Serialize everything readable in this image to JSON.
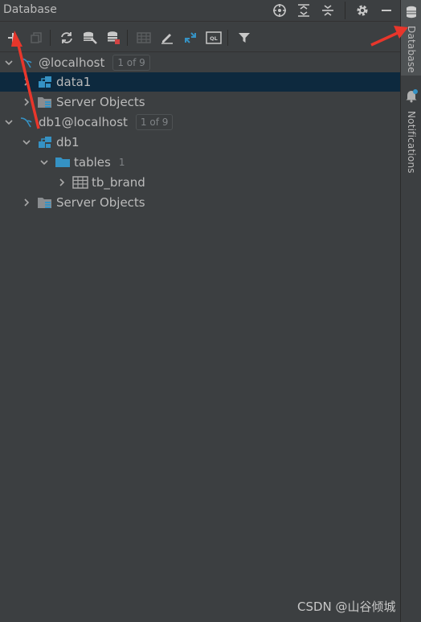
{
  "panel": {
    "title": "Database"
  },
  "title_actions": [
    "target-icon",
    "expand-all-icon",
    "collapse-all-icon",
    "gear-icon",
    "minimize-icon"
  ],
  "toolbar": {
    "icons": [
      "add-icon",
      "copy-icon",
      "refresh-icon",
      "data-source-properties-icon",
      "db-stop-icon",
      "table-view-icon",
      "edit-icon",
      "jump-to-source-icon",
      "query-console-icon",
      "filter-icon"
    ]
  },
  "tree": [
    {
      "label": "@localhost",
      "badge": "1 of 9",
      "expanded": true,
      "icon": "mysql-icon"
    },
    {
      "label": "data1",
      "icon": "schema-icon",
      "expanded": false,
      "selected": true
    },
    {
      "label": "Server Objects",
      "icon": "server-objects-icon",
      "expanded": false
    },
    {
      "label": "db1@localhost",
      "badge": "1 of 9",
      "expanded": true,
      "icon": "mysql-icon"
    },
    {
      "label": "db1",
      "icon": "schema-icon",
      "expanded": true
    },
    {
      "label": "tables",
      "count": "1",
      "icon": "folder-icon",
      "expanded": true
    },
    {
      "label": "tb_brand",
      "icon": "table-icon",
      "expanded": false
    },
    {
      "label": "Server Objects",
      "icon": "server-objects-icon",
      "expanded": false
    }
  ],
  "sidebar": {
    "database_tab": "Database",
    "notifications_tab": "Notifications"
  },
  "watermark": "CSDN @山谷倾城",
  "colors": {
    "background": "#3c3f41",
    "selection": "#0d293e",
    "accent": "#3592c4",
    "annotation": "#e8362b"
  }
}
